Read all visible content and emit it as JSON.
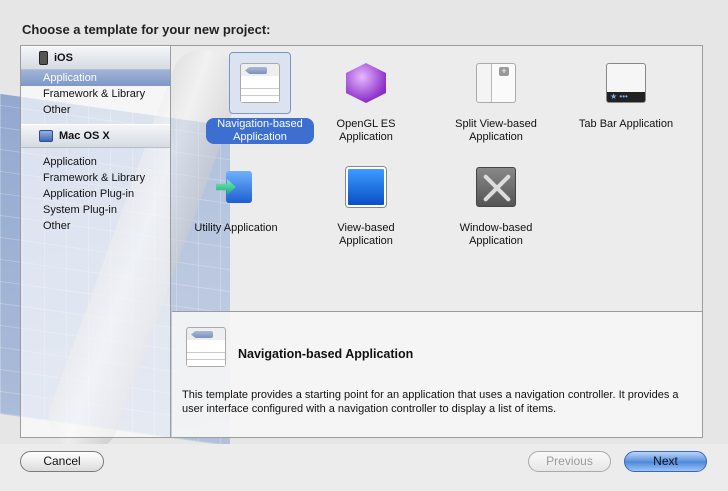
{
  "dialog": {
    "title": "Choose a template for your new project:"
  },
  "sidebar": {
    "groups": [
      {
        "name": "iOS",
        "icon": "iphone-icon",
        "items": [
          "Application",
          "Framework & Library",
          "Other"
        ],
        "selected_index": 0
      },
      {
        "name": "Mac OS X",
        "icon": "mac-icon",
        "items": [
          "Application",
          "Framework & Library",
          "Application Plug-in",
          "System Plug-in",
          "Other"
        ]
      }
    ]
  },
  "templates": [
    {
      "label": "Navigation-based Application",
      "icon": "navigation-template-icon",
      "selected": true
    },
    {
      "label": "OpenGL ES Application",
      "icon": "opengl-template-icon"
    },
    {
      "label": "Split View-based Application",
      "icon": "splitview-template-icon"
    },
    {
      "label": "Tab Bar Application",
      "icon": "tabbar-template-icon"
    },
    {
      "label": "Utility Application",
      "icon": "utility-template-icon"
    },
    {
      "label": "View-based Application",
      "icon": "view-template-icon"
    },
    {
      "label": "Window-based Application",
      "icon": "window-template-icon"
    }
  ],
  "description": {
    "title": "Navigation-based Application",
    "text": "This template provides a starting point for an application that uses a navigation controller. It provides a user interface configured with a navigation controller to display a list of items."
  },
  "buttons": {
    "cancel": "Cancel",
    "previous": "Previous",
    "next": "Next"
  },
  "colors": {
    "selection_blue": "#3d6fd0",
    "sidebar_selected": "#7e97c7"
  }
}
